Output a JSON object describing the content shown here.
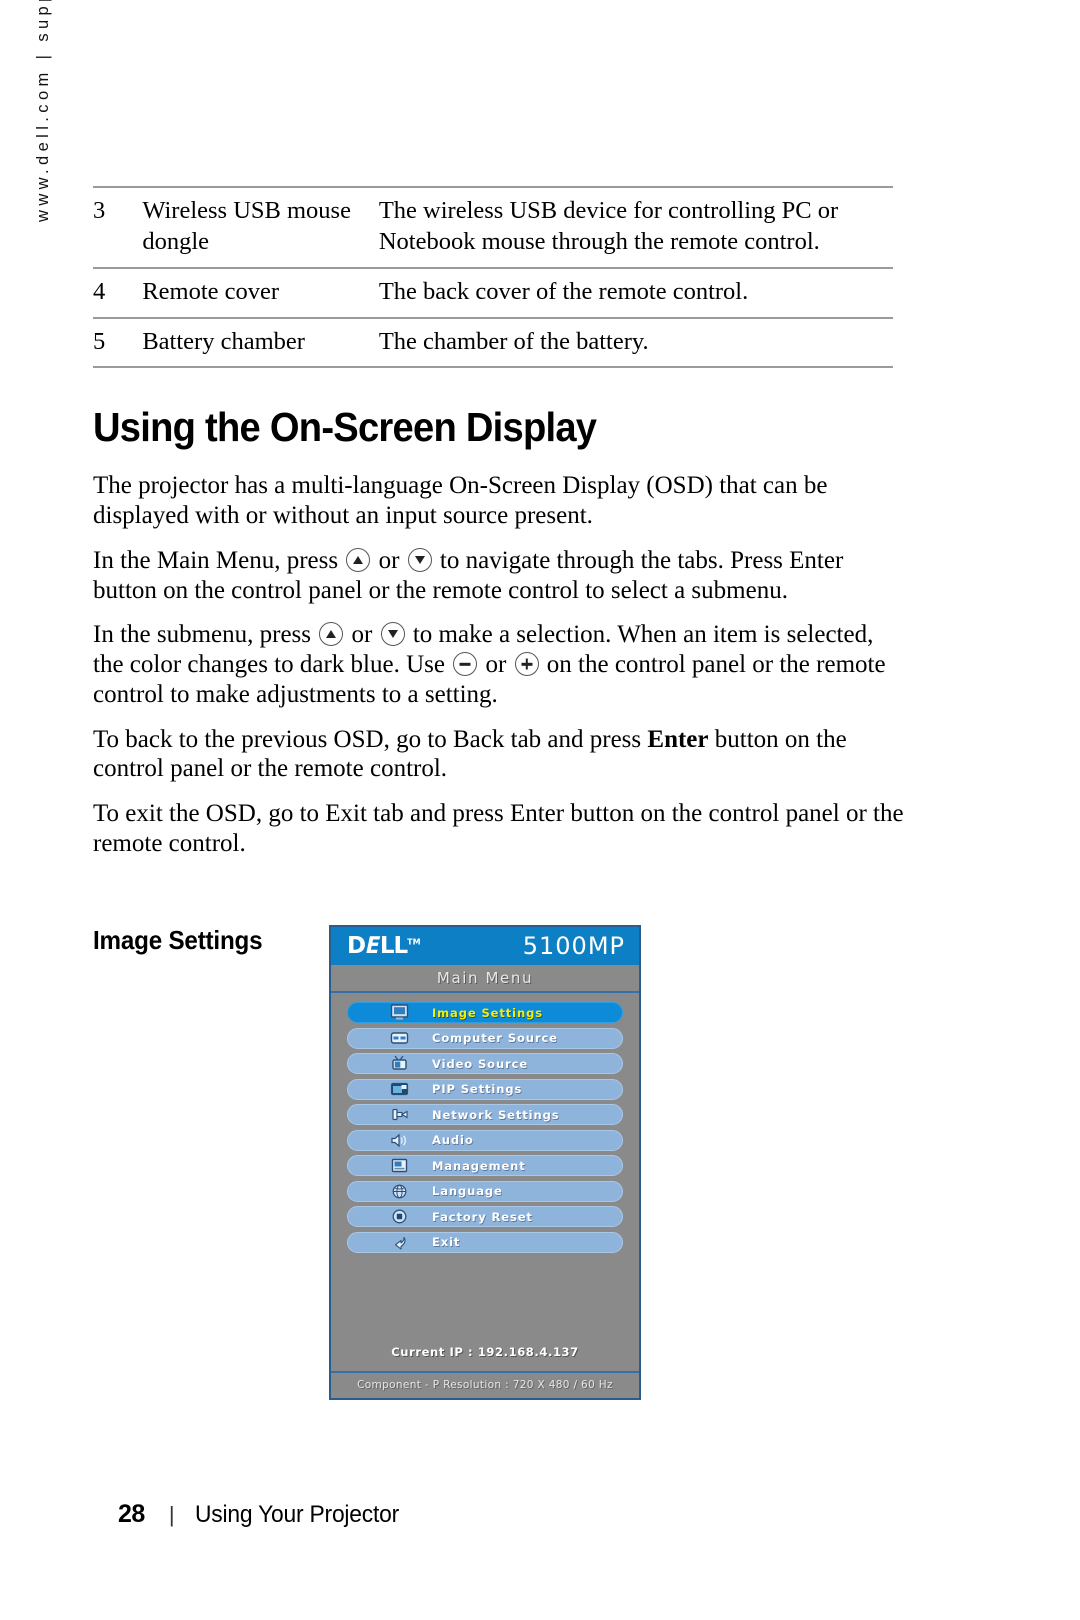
{
  "page": {
    "side_url": "www.dell.com | support.dell.com",
    "number": "28",
    "separator": "|",
    "footer_text": "Using Your Projector"
  },
  "table": {
    "rows": [
      {
        "num": "3",
        "name": "Wireless USB mouse dongle",
        "desc": "The wireless USB device for controlling PC or Notebook mouse through the remote control."
      },
      {
        "num": "4",
        "name": "Remote cover",
        "desc": "The back cover of the remote control."
      },
      {
        "num": "5",
        "name": "Battery chamber",
        "desc": "The chamber of the battery."
      }
    ]
  },
  "section": {
    "title": "Using the On-Screen Display",
    "sub_title": "Image Settings",
    "paragraphs": {
      "p1": "The projector has a multi-language On-Screen Display (OSD) that can be displayed with or without an input source present.",
      "p2_a": "In the Main Menu, press",
      "p2_or": "or",
      "p2_b": "to navigate through the tabs. Press Enter button on the control panel or the remote control to select a submenu.",
      "p3_a": "In the submenu, press",
      "p3_or1": "or",
      "p3_b": "to make a selection. When an item is selected, the color changes to dark blue. Use",
      "p3_or2": "or",
      "p3_c": "on the control panel or the remote control to make adjustments to a setting.",
      "p4_a": "To back to the previous OSD, go to Back tab and press",
      "p4_bold": "Enter",
      "p4_b": "button on the control panel or the remote control.",
      "p5": "To exit the OSD, go to Exit tab and press Enter button on the control panel or the remote control."
    }
  },
  "osd": {
    "brand": "D",
    "brand_e": "E",
    "brand_rest": "LL",
    "brand_tm": "TM",
    "model": "5100MP",
    "main_menu_label": "Main Menu",
    "current_ip": "Current IP : 192.168.4.137",
    "status_bar": "Component - P Resolution : 720 X 480 / 60 Hz",
    "colors": {
      "header_blue": "#0d7fc4",
      "panel_gray": "#8a8a8a",
      "item_blue": "#8fb4dc",
      "selected_blue": "#0d8ad8",
      "selected_text": "#f5f000",
      "border_blue": "#2c5c8a"
    },
    "items": [
      {
        "label": "Image Settings",
        "icon": "monitor-icon",
        "selected": true
      },
      {
        "label": "Computer Source",
        "icon": "computer-icon",
        "selected": false
      },
      {
        "label": "Video Source",
        "icon": "tv-icon",
        "selected": false
      },
      {
        "label": "PIP Settings",
        "icon": "pip-icon",
        "selected": false
      },
      {
        "label": "Network Settings",
        "icon": "network-icon",
        "selected": false
      },
      {
        "label": "Audio",
        "icon": "speaker-icon",
        "selected": false
      },
      {
        "label": "Management",
        "icon": "mgmt-icon",
        "selected": false
      },
      {
        "label": "Language",
        "icon": "globe-icon",
        "selected": false
      },
      {
        "label": "Factory Reset",
        "icon": "reset-icon",
        "selected": false
      },
      {
        "label": "Exit",
        "icon": "back-arrow-icon",
        "selected": false
      }
    ]
  }
}
